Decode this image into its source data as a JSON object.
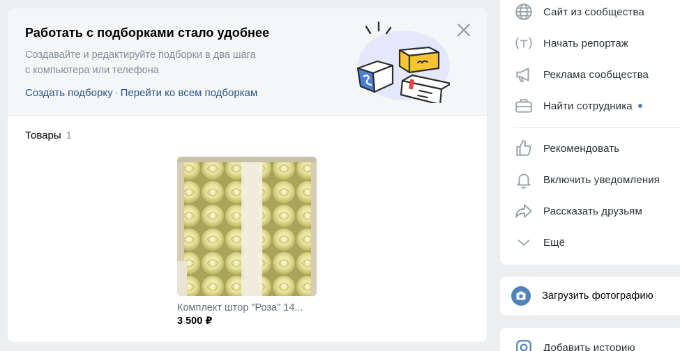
{
  "promo": {
    "title": "Работать с подборками стало удобнее",
    "description_line1": "Создавайте и редактируйте подборки в два шага",
    "description_line2": "с компьютера или телефона",
    "link_create": "Создать подборку",
    "separator": "·",
    "link_all": "Перейти ко всем подборкам",
    "close_icon": "close-icon",
    "illustration": "collections-boxes-illustration"
  },
  "goods": {
    "title": "Товары",
    "count": "1",
    "items": [
      {
        "name": "Комплект штор \"Роза\" 14...",
        "price": "3 500 ₽",
        "image": "yellow-roses-curtains"
      }
    ]
  },
  "side_menu": {
    "items": [
      {
        "label": "Сайт из сообщества",
        "icon": "globe-icon"
      },
      {
        "label": "Начать репортаж",
        "icon": "broadcast-icon"
      },
      {
        "label": "Реклама сообщества",
        "icon": "megaphone-icon"
      },
      {
        "label": "Найти сотрудника",
        "icon": "briefcase-icon",
        "badge_dot": true
      },
      {
        "label": "Рекомендовать",
        "icon": "thumb-up-icon"
      },
      {
        "label": "Включить уведомления",
        "icon": "bell-icon"
      },
      {
        "label": "Рассказать друзьям",
        "icon": "share-icon"
      },
      {
        "label": "Ещё",
        "icon": "chevron-down-icon"
      }
    ]
  },
  "upload": {
    "label": "Загрузить фотографию",
    "icon": "camera-icon"
  },
  "story": {
    "label": "Добавить историю",
    "icon": "story-camera-icon"
  },
  "colors": {
    "background": "#edeef0",
    "link": "#2a5885",
    "muted": "#818c99",
    "accent": "#5181b8",
    "icon": "#99a2ad"
  }
}
